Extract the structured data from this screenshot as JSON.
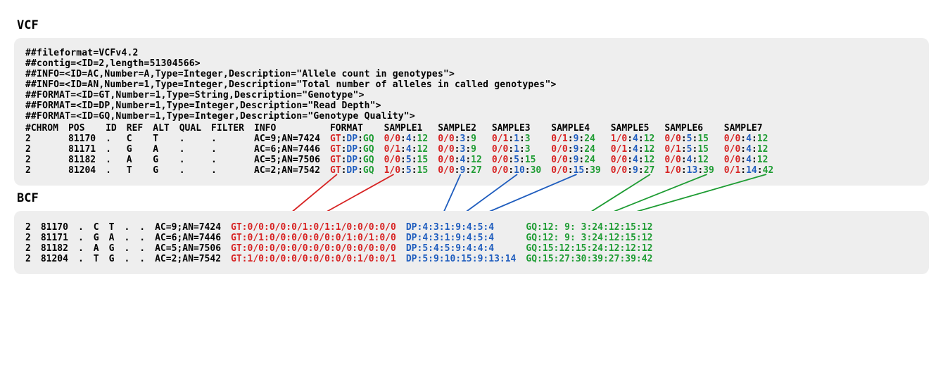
{
  "vcf": {
    "title": "VCF",
    "header_lines": [
      "##fileformat=VCFv4.2",
      "##contig=<ID=2,length=51304566>",
      "##INFO=<ID=AC,Number=A,Type=Integer,Description=\"Allele count in genotypes\">",
      "##INFO=<ID=AN,Number=1,Type=Integer,Description=\"Total number of alleles in called genotypes\">",
      "##FORMAT=<ID=GT,Number=1,Type=String,Description=\"Genotype\">",
      "##FORMAT=<ID=DP,Number=1,Type=Integer,Description=\"Read Depth\">",
      "##FORMAT=<ID=GQ,Number=1,Type=Integer,Description=\"Genotype Quality\">"
    ],
    "columns": [
      "#CHROM",
      "POS",
      "ID",
      "REF",
      "ALT",
      "QUAL",
      "FILTER",
      "INFO",
      "FORMAT",
      "SAMPLE1",
      "SAMPLE2",
      "SAMPLE3",
      "SAMPLE4",
      "SAMPLE5",
      "SAMPLE6",
      "SAMPLE7"
    ],
    "format_fields": {
      "gt": "GT",
      "dp": "DP",
      "gq": "GQ"
    },
    "rows": [
      {
        "chrom": "2",
        "pos": "81170",
        "id": ".",
        "ref": "C",
        "alt": "T",
        "qual": ".",
        "filter": ".",
        "info": "AC=9;AN=7424",
        "samples": [
          {
            "gt": "0/0",
            "dp": "4",
            "gq": "12"
          },
          {
            "gt": "0/0",
            "dp": "3",
            "gq": "9"
          },
          {
            "gt": "0/1",
            "dp": "1",
            "gq": "3"
          },
          {
            "gt": "0/1",
            "dp": "9",
            "gq": "24"
          },
          {
            "gt": "1/0",
            "dp": "4",
            "gq": "12"
          },
          {
            "gt": "0/0",
            "dp": "5",
            "gq": "15"
          },
          {
            "gt": "0/0",
            "dp": "4",
            "gq": "12"
          }
        ]
      },
      {
        "chrom": "2",
        "pos": "81171",
        "id": ".",
        "ref": "G",
        "alt": "A",
        "qual": ".",
        "filter": ".",
        "info": "AC=6;AN=7446",
        "samples": [
          {
            "gt": "0/1",
            "dp": "4",
            "gq": "12"
          },
          {
            "gt": "0/0",
            "dp": "3",
            "gq": "9"
          },
          {
            "gt": "0/0",
            "dp": "1",
            "gq": "3"
          },
          {
            "gt": "0/0",
            "dp": "9",
            "gq": "24"
          },
          {
            "gt": "0/1",
            "dp": "4",
            "gq": "12"
          },
          {
            "gt": "0/1",
            "dp": "5",
            "gq": "15"
          },
          {
            "gt": "0/0",
            "dp": "4",
            "gq": "12"
          }
        ]
      },
      {
        "chrom": "2",
        "pos": "81182",
        "id": ".",
        "ref": "A",
        "alt": "G",
        "qual": ".",
        "filter": ".",
        "info": "AC=5;AN=7506",
        "samples": [
          {
            "gt": "0/0",
            "dp": "5",
            "gq": "15"
          },
          {
            "gt": "0/0",
            "dp": "4",
            "gq": "12"
          },
          {
            "gt": "0/0",
            "dp": "5",
            "gq": "15"
          },
          {
            "gt": "0/0",
            "dp": "9",
            "gq": "24"
          },
          {
            "gt": "0/0",
            "dp": "4",
            "gq": "12"
          },
          {
            "gt": "0/0",
            "dp": "4",
            "gq": "12"
          },
          {
            "gt": "0/0",
            "dp": "4",
            "gq": "12"
          }
        ]
      },
      {
        "chrom": "2",
        "pos": "81204",
        "id": ".",
        "ref": "T",
        "alt": "G",
        "qual": ".",
        "filter": ".",
        "info": "AC=2;AN=7542",
        "samples": [
          {
            "gt": "1/0",
            "dp": "5",
            "gq": "15"
          },
          {
            "gt": "0/0",
            "dp": "9",
            "gq": "27"
          },
          {
            "gt": "0/0",
            "dp": "10",
            "gq": "30"
          },
          {
            "gt": "0/0",
            "dp": "15",
            "gq": "39"
          },
          {
            "gt": "0/0",
            "dp": "9",
            "gq": "27"
          },
          {
            "gt": "1/0",
            "dp": "13",
            "gq": "39"
          },
          {
            "gt": "0/1",
            "dp": "14",
            "gq": "42"
          }
        ]
      }
    ]
  },
  "bcf": {
    "title": "BCF",
    "rows": [
      {
        "chrom": "2",
        "pos": "81170",
        "id": ".",
        "ref": "C",
        "alt": "T",
        "qual": ".",
        "filter": ".",
        "info": "AC=9;AN=7424",
        "gt": "GT:0/0:0/0:0/1:0/1:1/0:0/0:0/0",
        "dp": "DP:4:3:1:9:4:5:4",
        "gq": "GQ:12: 9: 3:24:12:15:12"
      },
      {
        "chrom": "2",
        "pos": "81171",
        "id": ".",
        "ref": "G",
        "alt": "A",
        "qual": ".",
        "filter": ".",
        "info": "AC=6;AN=7446",
        "gt": "GT:0/1:0/0:0/0:0/0:0/1:0/1:0/0",
        "dp": "DP:4:3:1:9:4:5:4",
        "gq": "GQ:12: 9: 3:24:12:15:12"
      },
      {
        "chrom": "2",
        "pos": "81182",
        "id": ".",
        "ref": "A",
        "alt": "G",
        "qual": ".",
        "filter": ".",
        "info": "AC=5;AN=7506",
        "gt": "GT:0/0:0/0:0/0:0/0:0/0:0/0:0/0",
        "dp": "DP:5:4:5:9:4:4:4",
        "gq": "GQ:15:12:15:24:12:12:12"
      },
      {
        "chrom": "2",
        "pos": "81204",
        "id": ".",
        "ref": "T",
        "alt": "G",
        "qual": ".",
        "filter": ".",
        "info": "AC=2;AN=7542",
        "gt": "GT:1/0:0/0:0/0:0/0:0/0:1/0:0/1",
        "dp": "DP:5:9:10:15:9:13:14",
        "gq": "GQ:15:27:30:39:27:39:42"
      }
    ]
  },
  "colors": {
    "gt": "#d72323",
    "dp": "#1f5dbe",
    "gq": "#1e9c33"
  }
}
